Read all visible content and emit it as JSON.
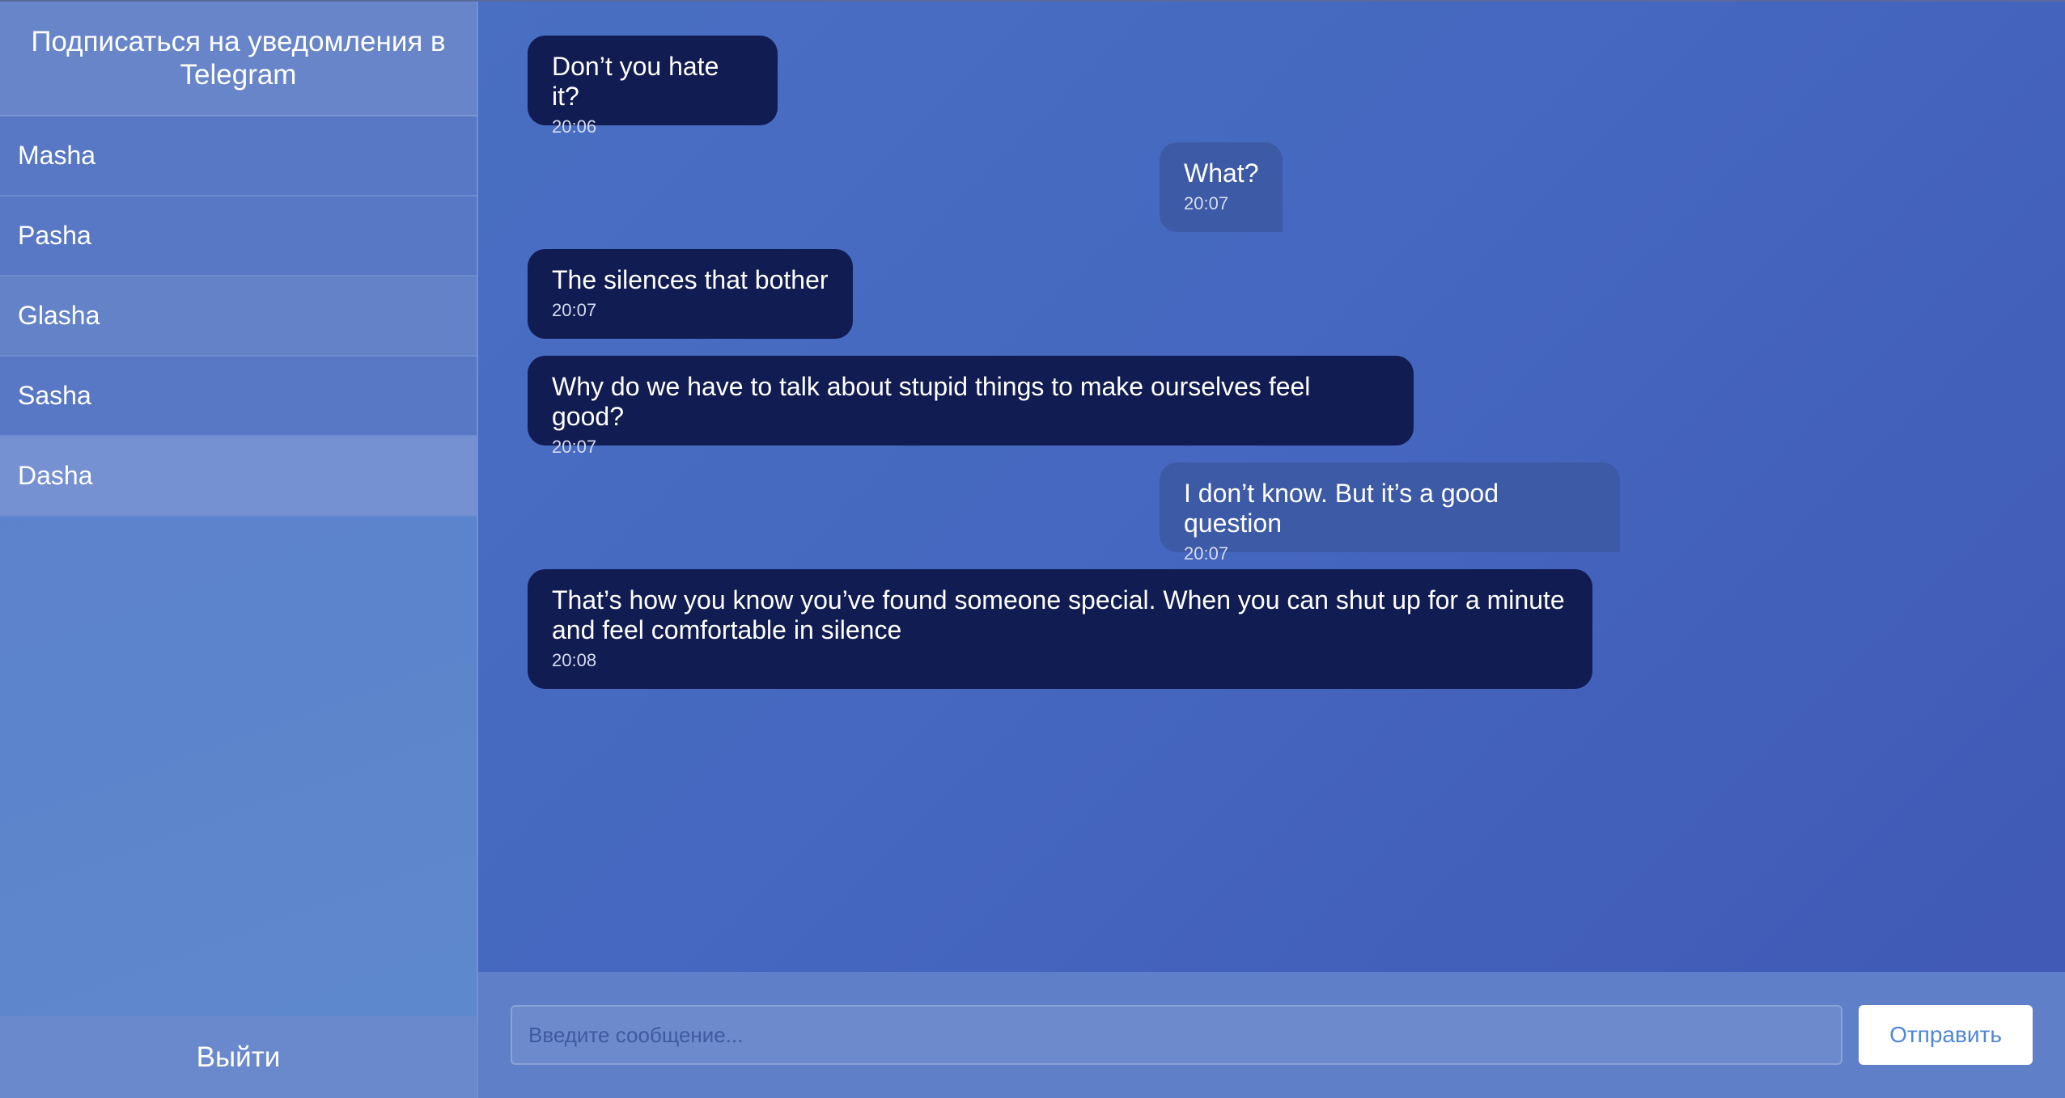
{
  "sidebar": {
    "subscribe_label": "Подписаться на уведомления в Telegram",
    "contacts": [
      {
        "name": "Masha"
      },
      {
        "name": "Pasha"
      },
      {
        "name": "Glasha"
      },
      {
        "name": "Sasha"
      },
      {
        "name": "Dasha"
      }
    ],
    "active_contact": "Dasha",
    "logout_label": "Выйти"
  },
  "messages": [
    {
      "direction": "in",
      "text": "Don’t you hate it?",
      "time": "20:06"
    },
    {
      "direction": "out",
      "text": "What?",
      "time": "20:07"
    },
    {
      "direction": "in",
      "text": "The silences that bother",
      "time": "20:07"
    },
    {
      "direction": "in",
      "text": "Why do we have to talk about stupid things to make ourselves feel good?",
      "time": "20:07"
    },
    {
      "direction": "out",
      "text": "I don’t know. But it’s a good question",
      "time": "20:07"
    },
    {
      "direction": "in",
      "text": "That’s how you know you’ve found someone special. When you can shut up for a minute and feel comfortable in silence",
      "time": "20:08"
    }
  ],
  "composer": {
    "value": "",
    "placeholder": "Введите сообщение...",
    "send_label": "Отправить"
  },
  "colors": {
    "incoming_bubble": "#111c52",
    "outgoing_bubble": "#3d5aa6",
    "send_text": "#4f86d8"
  }
}
